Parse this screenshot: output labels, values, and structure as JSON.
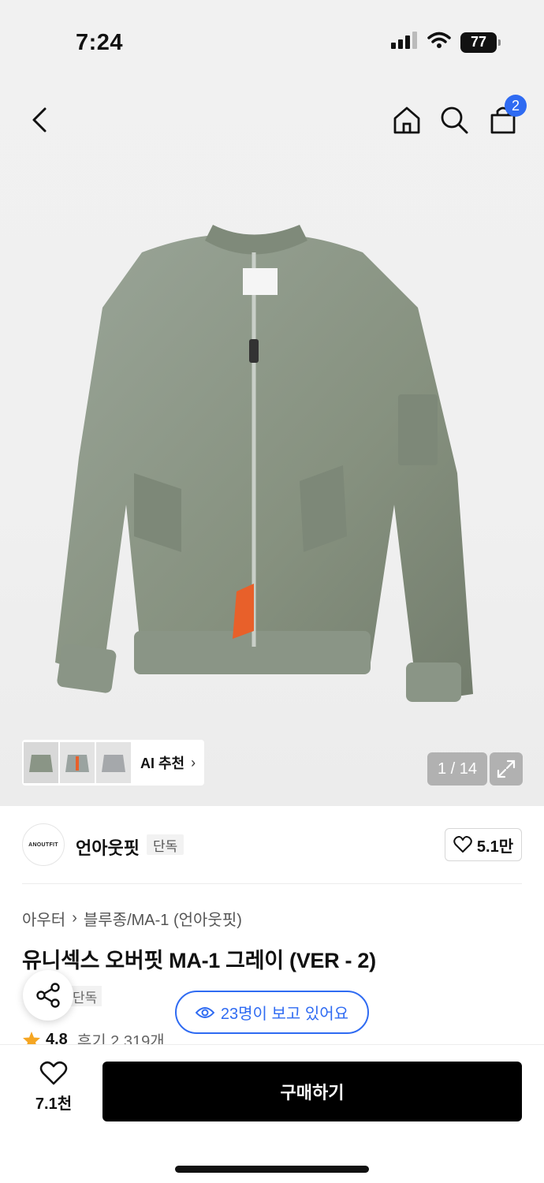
{
  "status": {
    "time": "7:24",
    "battery": "77"
  },
  "nav": {
    "cart_count": "2"
  },
  "gallery": {
    "ai_label": "AI 추천",
    "ai_chevron": "›",
    "counter": "1 / 14"
  },
  "brand": {
    "logo_text": "ANOUTFIT",
    "name": "언아웃핏",
    "tag": "단독",
    "likes": "5.1만"
  },
  "product": {
    "breadcrumb": [
      "아우터",
      "블루종/MA-1 (언아웃핏)"
    ],
    "breadcrumb_sep": "›",
    "title": "유니섹스 오버핏 MA-1 그레이 (VER - 2)",
    "tag": "단독",
    "viewers": "23명이 보고 있어요",
    "rating": "4.8",
    "reviews": "후기 2,319개"
  },
  "bottom": {
    "wish_count": "7.1천",
    "buy_label": "구매하기"
  },
  "colors": {
    "accent_blue": "#2f6bf2",
    "star": "#f5a623",
    "jacket": "#8b968a"
  }
}
